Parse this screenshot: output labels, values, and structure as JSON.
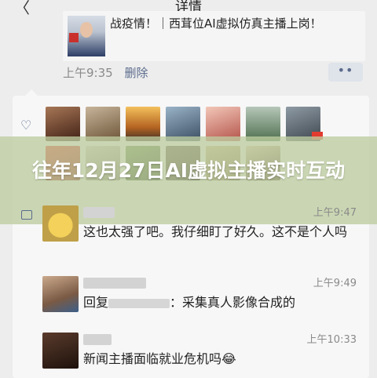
{
  "header": {
    "back_symbol": "〈",
    "title": "详情"
  },
  "post": {
    "text": "战疫情！｜西茸位AI虚拟仿真主播上岗！",
    "time": "上午9:35",
    "delete_label": "删除",
    "more_symbol": "••"
  },
  "likes": {
    "icon": "heart-icon",
    "avatars": 13
  },
  "banner": {
    "text": "往年12月27日AI虚拟主播实时互动"
  },
  "comments": [
    {
      "time": "上午9:47",
      "text": "这也太强了吧。我仔细盯了好久。这不是个人吗"
    },
    {
      "time": "上午9:49",
      "prefix": "回复",
      "text": "：采集真人影像合成的"
    },
    {
      "time": "上午10:33",
      "text": "新闻主播面临就业危机吗😂"
    }
  ],
  "colors": {
    "background": "#ededed",
    "link": "#5a6b8c",
    "banner": "#becda0"
  }
}
